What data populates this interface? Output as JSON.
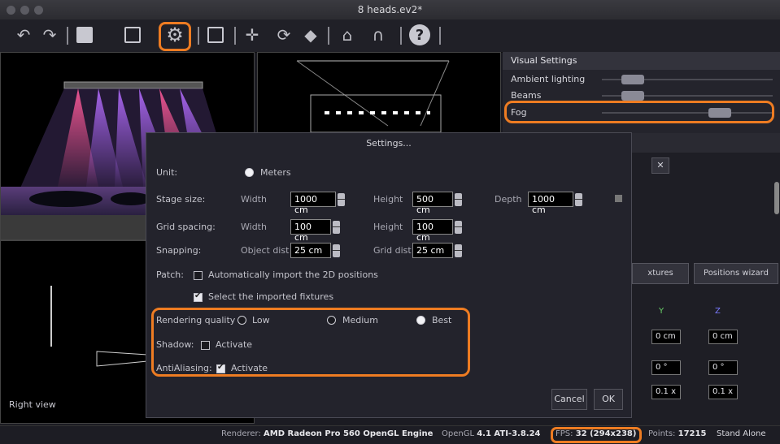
{
  "window": {
    "title": "8 heads.ev2*"
  },
  "toolbar": {
    "icons": [
      "undo-icon",
      "redo-icon",
      "frame-icon",
      "import-icon",
      "settings-icon",
      "chart-icon",
      "move-icon",
      "rotate-icon",
      "diamond-icon",
      "gobo-icon",
      "magnet-icon",
      "help-icon"
    ]
  },
  "viewports": {
    "right_view_label": "Right view"
  },
  "visual_settings": {
    "title": "Visual Settings",
    "sliders": [
      {
        "label": "Ambient lighting",
        "value": 0.13
      },
      {
        "label": "Beams",
        "value": 0.13
      },
      {
        "label": "Fog",
        "value": 0.72
      }
    ]
  },
  "right_panel": {
    "close_glyph": "✕",
    "tab_fixtures": "xtures",
    "tab_positions": "Positions wizard",
    "col_y": "Y",
    "col_z": "Z",
    "row1": [
      "0 cm",
      "0 cm"
    ],
    "row2": [
      "0 °",
      "0 °"
    ],
    "row3": [
      "0.1 x",
      "0.1 x"
    ]
  },
  "dialog": {
    "title": "Settings...",
    "unit": {
      "label": "Unit:",
      "option": "Meters"
    },
    "stage_size": {
      "label": "Stage size:",
      "width_label": "Width",
      "width": "1000 cm",
      "height_label": "Height",
      "height": "500 cm",
      "depth_label": "Depth",
      "depth": "1000 cm"
    },
    "grid_spacing": {
      "label": "Grid spacing:",
      "width_label": "Width",
      "width": "100 cm",
      "height_label": "Height",
      "height": "100 cm"
    },
    "snapping": {
      "label": "Snapping:",
      "object_label": "Object dist",
      "object": "25 cm",
      "grid_label": "Grid dist",
      "grid": "25 cm"
    },
    "patch": {
      "label": "Patch:",
      "auto_import": "Automatically import the 2D positions",
      "select_imported": "Select the imported fixtures"
    },
    "rendering": {
      "label": "Rendering quality",
      "low": "Low",
      "medium": "Medium",
      "best": "Best",
      "selected": "Best"
    },
    "shadow": {
      "label": "Shadow:",
      "activate": "Activate"
    },
    "antialiasing": {
      "label": "AntiAliasing:",
      "activate": "Activate"
    },
    "cancel": "Cancel",
    "ok": "OK"
  },
  "status": {
    "renderer_label": "Renderer:",
    "renderer": "AMD Radeon Pro 560 OpenGL Engine",
    "opengl_label": "OpenGL",
    "opengl": "4.1 ATI-3.8.24",
    "fps_label": "FPS:",
    "fps": "32 (294x238)",
    "points_label": "Points:",
    "points": "17215",
    "mode": "Stand Alone"
  },
  "colors": {
    "highlight": "#ee7c22",
    "background": "#1b1b22"
  }
}
